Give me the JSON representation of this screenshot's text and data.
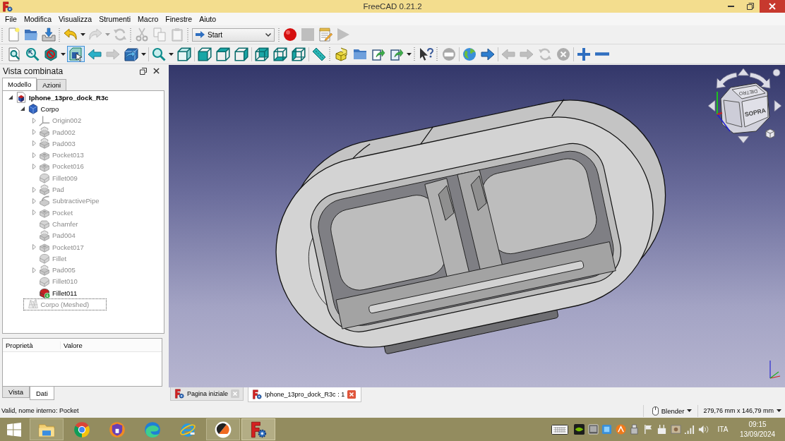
{
  "window": {
    "title": "FreeCAD 0.21.2"
  },
  "menu_bar": [
    "File",
    "Modifica",
    "Visualizza",
    "Strumenti",
    "Macro",
    "Finestre",
    "Aiuto"
  ],
  "toolbar_rows": [
    [
      {
        "items": [
          {
            "kind": "button",
            "disabled": false
          },
          {
            "kind": "button",
            "disabled": false
          },
          {
            "kind": "button",
            "disabled": false
          }
        ]
      },
      {
        "items": [
          {
            "kind": "menu-button",
            "disabled": false
          },
          {
            "kind": "menu-button",
            "disabled": true
          },
          {
            "kind": "button",
            "disabled": true
          }
        ]
      },
      {
        "items": [
          {
            "kind": "button",
            "disabled": true
          },
          {
            "kind": "button",
            "disabled": true
          },
          {
            "kind": "button",
            "disabled": true
          }
        ]
      },
      {
        "items": [
          {
            "kind": "combo",
            "value": "Start",
            "disabled": false
          }
        ]
      },
      {
        "items": [
          {
            "kind": "button",
            "disabled": false
          },
          {
            "kind": "button",
            "disabled": true
          },
          {
            "kind": "button",
            "disabled": false
          },
          {
            "kind": "button",
            "disabled": true
          }
        ]
      }
    ],
    [
      {
        "items": [
          {
            "kind": "button",
            "disabled": false,
            "pressed": false
          },
          {
            "kind": "button",
            "disabled": false,
            "pressed": false
          },
          {
            "kind": "menu-button",
            "disabled": false,
            "pressed": false
          },
          {
            "kind": "button",
            "disabled": false,
            "pressed": true
          },
          {
            "kind": "button",
            "disabled": false,
            "pressed": false
          },
          {
            "kind": "button",
            "disabled": true,
            "pressed": false
          },
          {
            "kind": "menu-button",
            "disabled": false,
            "pressed": false
          },
          {
            "kind": "separator"
          },
          {
            "kind": "menu-button",
            "disabled": false,
            "pressed": false
          },
          {
            "kind": "button",
            "disabled": false,
            "pressed": false
          },
          {
            "kind": "separator"
          },
          {
            "kind": "button",
            "disabled": false,
            "pressed": false
          },
          {
            "kind": "button",
            "disabled": false,
            "pressed": false
          },
          {
            "kind": "button",
            "disabled": false,
            "pressed": false
          },
          {
            "kind": "separator"
          },
          {
            "kind": "button",
            "disabled": false,
            "pressed": false
          },
          {
            "kind": "button",
            "disabled": false,
            "pressed": false
          },
          {
            "kind": "button",
            "disabled": false,
            "pressed": false
          },
          {
            "kind": "separator"
          },
          {
            "kind": "button",
            "disabled": false,
            "pressed": false
          }
        ]
      },
      {
        "items": [
          {
            "kind": "button",
            "disabled": false,
            "pressed": false
          },
          {
            "kind": "button",
            "disabled": false,
            "pressed": false
          },
          {
            "kind": "button",
            "disabled": false,
            "pressed": false
          },
          {
            "kind": "menu-button",
            "disabled": false,
            "pressed": false
          }
        ]
      },
      {
        "items": [
          {
            "kind": "button",
            "disabled": false,
            "pressed": false
          }
        ]
      },
      {
        "items": [
          {
            "kind": "button",
            "disabled": false,
            "pressed": false
          },
          {
            "kind": "separator"
          },
          {
            "kind": "button",
            "disabled": false,
            "pressed": false
          },
          {
            "kind": "button",
            "disabled": false,
            "pressed": false
          },
          {
            "kind": "separator"
          },
          {
            "kind": "button",
            "disabled": true,
            "pressed": false
          },
          {
            "kind": "button",
            "disabled": true,
            "pressed": false
          },
          {
            "kind": "button",
            "disabled": true,
            "pressed": false
          },
          {
            "kind": "button",
            "disabled": true,
            "pressed": false
          },
          {
            "kind": "separator"
          },
          {
            "kind": "button",
            "disabled": false,
            "pressed": false
          },
          {
            "kind": "button",
            "disabled": false,
            "pressed": false
          }
        ]
      }
    ]
  ],
  "combo_view": {
    "title": "Vista combinata",
    "tabs": [
      {
        "label": "Modello",
        "selected": true
      },
      {
        "label": "Azioni",
        "selected": false
      }
    ],
    "tree": [
      {
        "label": "Iphone_13pro_dock_R3c",
        "kind": "document",
        "expanded": true,
        "visible": true,
        "tip": false,
        "selected": false,
        "children": [
          {
            "label": "Corpo",
            "kind": "body",
            "expanded": true,
            "visible": true,
            "tip": false,
            "selected": false,
            "children": [
              {
                "label": "Origin002",
                "kind": "origin",
                "expanded": false,
                "visible": false,
                "tip": false,
                "selected": false
              },
              {
                "label": "Pad002",
                "kind": "pad",
                "expanded": false,
                "visible": false,
                "tip": false,
                "selected": false
              },
              {
                "label": "Pad003",
                "kind": "pad",
                "expanded": false,
                "visible": false,
                "tip": false,
                "selected": false
              },
              {
                "label": "Pocket013",
                "kind": "pocket",
                "expanded": false,
                "visible": false,
                "tip": false,
                "selected": false
              },
              {
                "label": "Pocket016",
                "kind": "pocket",
                "expanded": false,
                "visible": false,
                "tip": false,
                "selected": false
              },
              {
                "label": "Fillet009",
                "kind": "fillet",
                "visible": false,
                "tip": false,
                "selected": false
              },
              {
                "label": "Pad",
                "kind": "pad",
                "expanded": false,
                "visible": false,
                "tip": false,
                "selected": false
              },
              {
                "label": "SubtractivePipe",
                "kind": "pipe",
                "expanded": false,
                "visible": false,
                "tip": false,
                "selected": false
              },
              {
                "label": "Pocket",
                "kind": "pocket",
                "expanded": false,
                "visible": false,
                "tip": false,
                "selected": false
              },
              {
                "label": "Chamfer",
                "kind": "chamfer",
                "visible": false,
                "tip": false,
                "selected": false
              },
              {
                "label": "Pad004",
                "kind": "pad",
                "visible": false,
                "tip": false,
                "selected": false
              },
              {
                "label": "Pocket017",
                "kind": "pocket",
                "expanded": false,
                "visible": false,
                "tip": false,
                "selected": false
              },
              {
                "label": "Fillet",
                "kind": "fillet",
                "visible": false,
                "tip": false,
                "selected": false
              },
              {
                "label": "Pad005",
                "kind": "pad",
                "expanded": false,
                "visible": false,
                "tip": false,
                "selected": false
              },
              {
                "label": "Fillet010",
                "kind": "fillet",
                "visible": false,
                "tip": false,
                "selected": false
              },
              {
                "label": "Fillet011",
                "kind": "fillet",
                "visible": true,
                "tip": true,
                "selected": false
              }
            ]
          },
          {
            "label": "Corpo (Meshed)",
            "kind": "mesh",
            "visible": false,
            "tip": false,
            "selected": true
          }
        ]
      }
    ],
    "property_columns": [
      "Proprietà",
      "Valore"
    ],
    "bottom_tabs": [
      {
        "label": "Vista",
        "selected": false
      },
      {
        "label": "Dati",
        "selected": true
      }
    ]
  },
  "view_cube": {
    "faces": [
      "DIETRO",
      "SOPRA"
    ]
  },
  "document_tabs": [
    {
      "label": "Pagina iniziale",
      "selected": false
    },
    {
      "label": "Iphone_13pro_dock_R3c : 1",
      "selected": true
    }
  ],
  "status_bar": {
    "message": "Valid, nome interno: Pocket",
    "navigation_style": "Blender",
    "dimensions": "279,76 mm x 146,79 mm"
  },
  "taskbar": {
    "apps": [
      {
        "running": true,
        "selected": false
      },
      {
        "running": false,
        "selected": false
      },
      {
        "running": false,
        "selected": false
      },
      {
        "running": false,
        "selected": false
      },
      {
        "running": false,
        "selected": false
      },
      {
        "running": true,
        "selected": false
      },
      {
        "running": true,
        "selected": true
      }
    ],
    "tray": {
      "language": "ITA",
      "time": "09:15",
      "date": "13/09/2024"
    }
  }
}
